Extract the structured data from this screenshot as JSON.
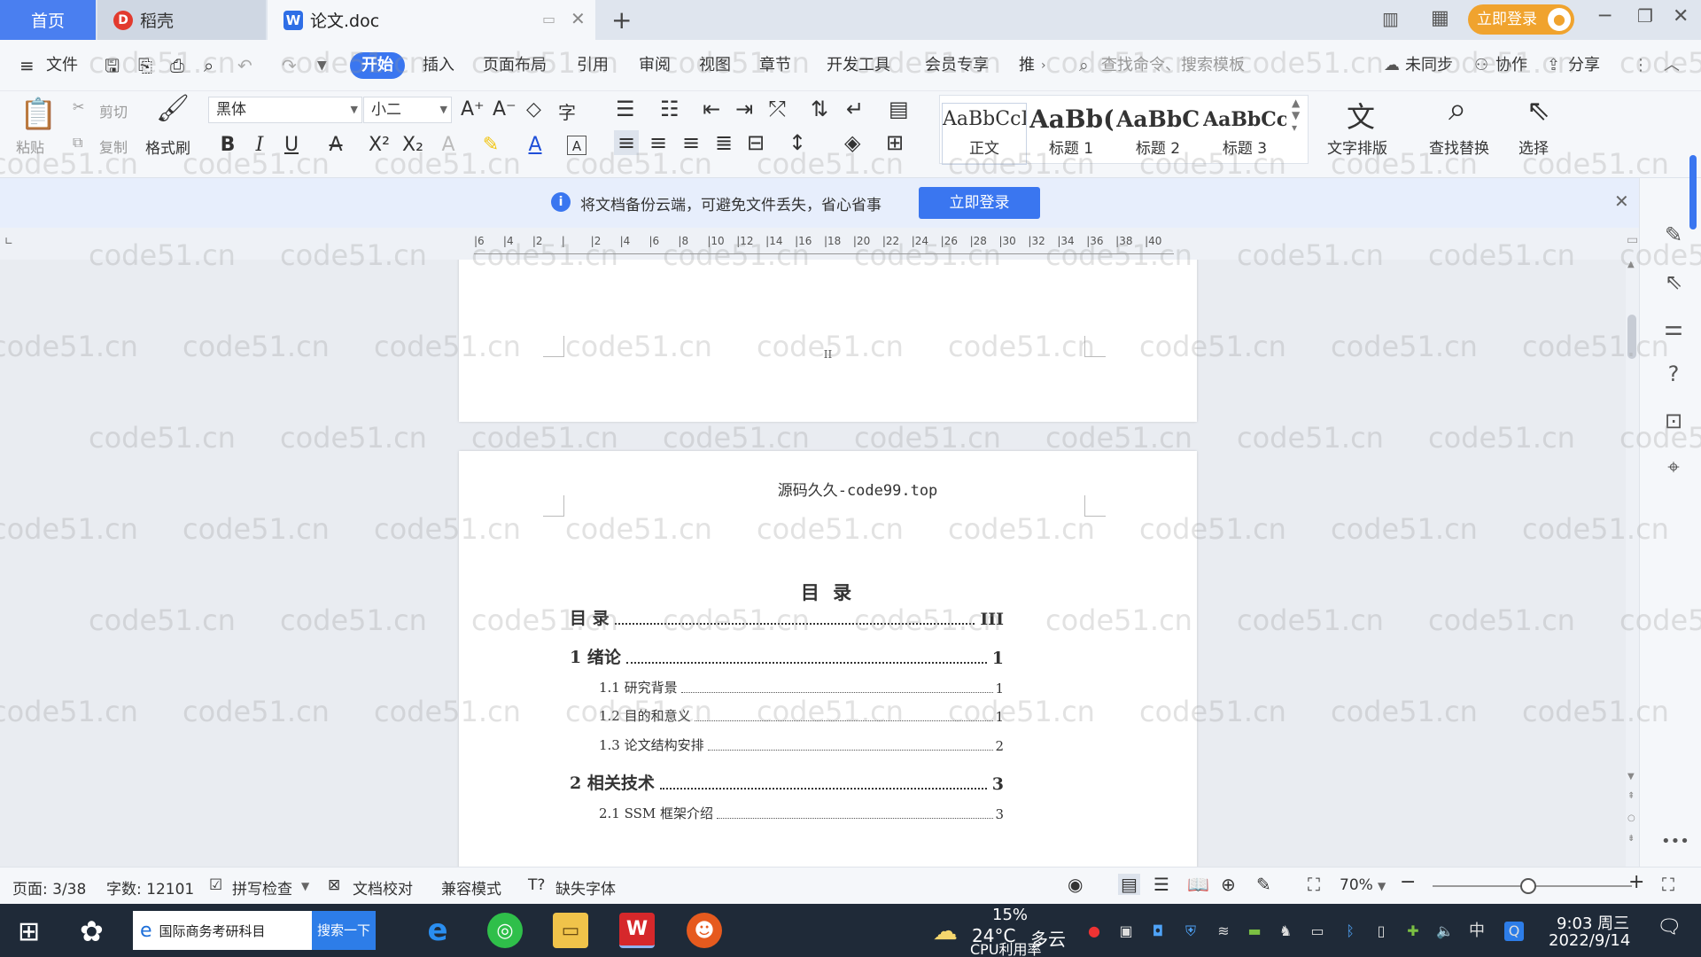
{
  "tabs": {
    "home": "首页",
    "daoke": "稻壳",
    "doc": "论文.doc",
    "add": "+"
  },
  "titlebar": {
    "login": "立即登录"
  },
  "menu": {
    "file": "文件",
    "items": [
      "开始",
      "插入",
      "页面布局",
      "引用",
      "审阅",
      "视图",
      "章节",
      "开发工具",
      "会员专享",
      "推"
    ],
    "search_placeholder": "查找命令、搜索模板",
    "unsynced": "未同步",
    "collab": "协作",
    "share": "分享"
  },
  "ribbon": {
    "paste": "粘贴",
    "cut": "剪切",
    "copy": "复制",
    "format_painter": "格式刷",
    "font_name": "黑体",
    "font_size": "小二",
    "styles": [
      {
        "preview": "AaBbCcI",
        "name": "正文"
      },
      {
        "preview": "AaBb(",
        "name": "标题 1"
      },
      {
        "preview": "AaBbC",
        "name": "标题 2"
      },
      {
        "preview": "AaBbCcl",
        "name": "标题 3"
      }
    ],
    "text_layout": "文字排版",
    "find_replace": "查找替换",
    "select": "选择"
  },
  "notify": {
    "text": "将文档备份云端，可避免文件丢失，省心省事",
    "button": "立即登录"
  },
  "ruler": {
    "ticks": [
      "6",
      "4",
      "2",
      "",
      "2",
      "4",
      "6",
      "8",
      "10",
      "12",
      "14",
      "16",
      "18",
      "20",
      "22",
      "24",
      "26",
      "28",
      "30",
      "32",
      "34",
      "36",
      "38",
      "40"
    ]
  },
  "document": {
    "prev_page_number": "II",
    "header": "源码久久-code99.top",
    "toc_title": "目 录",
    "toc": [
      {
        "level": 1,
        "label": "目 录",
        "page": "III"
      },
      {
        "level": 1,
        "label": "1 绪论",
        "page": "1"
      },
      {
        "level": 2,
        "label": "1.1 研究背景",
        "page": "1"
      },
      {
        "level": 2,
        "label": "1.2 目的和意义",
        "page": "1"
      },
      {
        "level": 2,
        "label": "1.3 论文结构安排",
        "page": "2"
      },
      {
        "level": 1,
        "label": "2 相关技术",
        "page": "3"
      },
      {
        "level": 2,
        "label": "2.1 SSM 框架介绍",
        "page": "3"
      }
    ]
  },
  "watermark": "code51.cn",
  "status": {
    "page": "页面: 3/38",
    "words": "字数: 12101",
    "spell": "拼写检查",
    "proof": "文档校对",
    "compat": "兼容模式",
    "missing_font": "缺失字体",
    "zoom": "70%",
    "zoom_level": 0.48
  },
  "taskbar": {
    "search_text": "国际商务考研科目",
    "search_button": "搜索一下",
    "weather_temp": "24°C",
    "weather_desc": "多云",
    "cpu_pct": "15%",
    "cpu_label": "CPU利用率",
    "ime": "中",
    "time": "9:03 周三",
    "date": "2022/9/14"
  }
}
